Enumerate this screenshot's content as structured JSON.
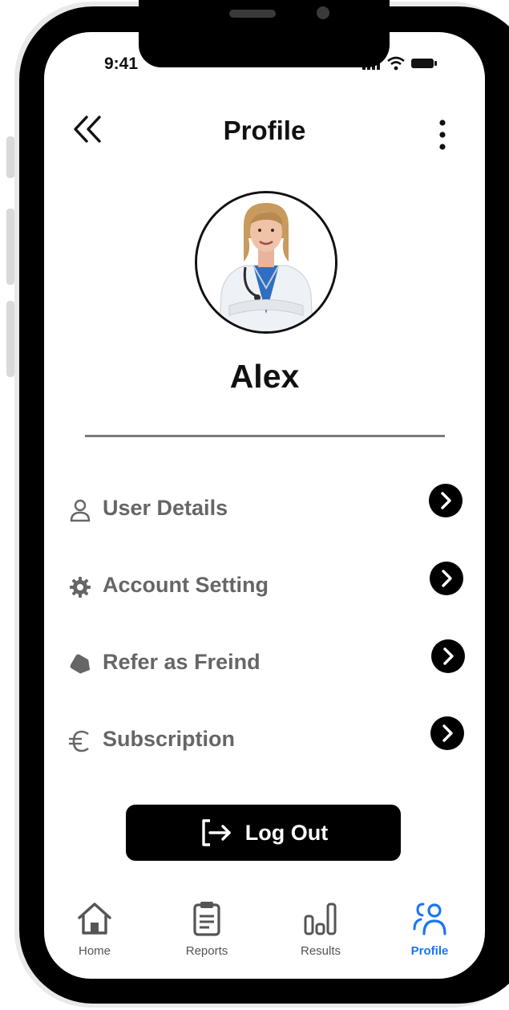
{
  "status_bar": {
    "time": "9:41"
  },
  "header": {
    "title": "Profile",
    "back_icon": "double-chevron-left-icon",
    "more_icon": "vertical-dots-icon"
  },
  "profile": {
    "name": "Alex",
    "avatar_desc": "doctor-photo"
  },
  "menu": {
    "items": [
      {
        "label": "User Details",
        "icon": "user-icon"
      },
      {
        "label": "Account Setting",
        "icon": "gear-icon"
      },
      {
        "label": "Refer as Freind",
        "icon": "tag-icon"
      },
      {
        "label": "Subscription",
        "icon": "euro-icon"
      }
    ]
  },
  "logout": {
    "label": "Log Out",
    "icon": "logout-icon"
  },
  "bottom_nav": {
    "items": [
      {
        "label": "Home",
        "icon": "home-icon",
        "active": false
      },
      {
        "label": "Reports",
        "icon": "clipboard-icon",
        "active": false
      },
      {
        "label": "Results",
        "icon": "bar-chart-icon",
        "active": false
      },
      {
        "label": "Profile",
        "icon": "user-group-icon",
        "active": true
      }
    ]
  },
  "colors": {
    "accent": "#1976f0",
    "text_primary": "#111111",
    "text_secondary": "#666666",
    "frame": "#000000"
  }
}
